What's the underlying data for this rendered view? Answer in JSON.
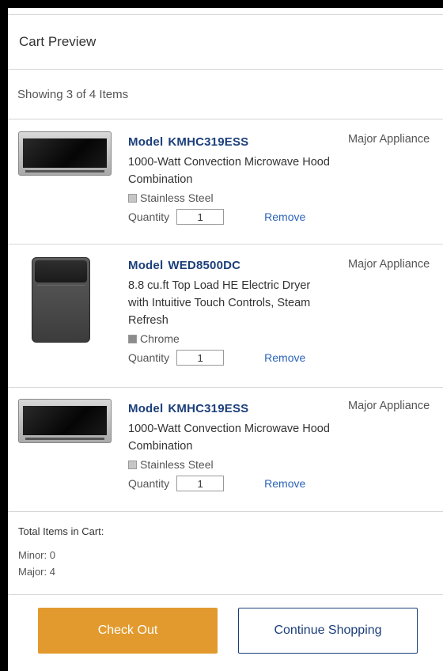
{
  "header": {
    "title": "Cart Preview"
  },
  "summary": {
    "showing": "Showing 3 of 4 Items"
  },
  "items": [
    {
      "model_prefix": "Model",
      "model_number": "KMHC319ESS",
      "description": "1000-Watt Convection Microwave Hood Combination",
      "color": "Stainless Steel",
      "swatch_color": "#c6c6c6",
      "quantity_label": "Quantity",
      "quantity": "1",
      "remove_label": "Remove",
      "category": "Major Appliance",
      "image": "microwave-hood-image"
    },
    {
      "model_prefix": "Model",
      "model_number": "WED8500DC",
      "description": "8.8 cu.ft Top Load HE Electric Dryer with Intuitive Touch Controls, Steam Refresh",
      "color": "Chrome",
      "swatch_color": "#8c8c8c",
      "quantity_label": "Quantity",
      "quantity": "1",
      "remove_label": "Remove",
      "category": "Major Appliance",
      "image": "dryer-image"
    },
    {
      "model_prefix": "Model",
      "model_number": "KMHC319ESS",
      "description": "1000-Watt Convection Microwave Hood Combination",
      "color": "Stainless Steel",
      "swatch_color": "#c6c6c6",
      "quantity_label": "Quantity",
      "quantity": "1",
      "remove_label": "Remove",
      "category": "Major Appliance",
      "image": "microwave-hood-image"
    }
  ],
  "totals": {
    "title": "Total Items in Cart:",
    "minor": "Minor: 0",
    "major": "Major: 4"
  },
  "actions": {
    "checkout_label": "Check Out",
    "continue_label": "Continue Shopping"
  },
  "colors": {
    "accent": "#e29a2e",
    "link": "#2b63b8",
    "model_text": "#1c3f7a"
  }
}
